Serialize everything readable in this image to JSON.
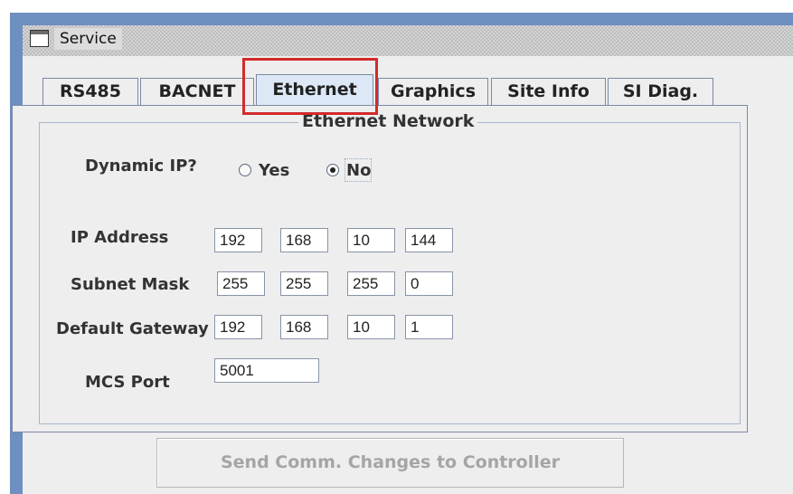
{
  "window": {
    "title": "Service",
    "icon": "window-icon"
  },
  "tabs": [
    {
      "label": "RS485",
      "active": false
    },
    {
      "label": "BACNET",
      "active": false
    },
    {
      "label": "Ethernet",
      "active": true
    },
    {
      "label": "Graphics",
      "active": false
    },
    {
      "label": "Site Info",
      "active": false
    },
    {
      "label": "SI Diag.",
      "active": false
    }
  ],
  "group": {
    "title": "Ethernet Network"
  },
  "dynamic_ip": {
    "label": "Dynamic IP?",
    "options": [
      {
        "label": "Yes",
        "selected": false
      },
      {
        "label": "No",
        "selected": true
      }
    ]
  },
  "ip_address": {
    "label": "IP Address",
    "octets": [
      "192",
      "168",
      "10",
      "144"
    ]
  },
  "subnet_mask": {
    "label": "Subnet Mask",
    "octets": [
      "255",
      "255",
      "255",
      "0"
    ]
  },
  "default_gateway": {
    "label": "Default Gateway",
    "octets": [
      "192",
      "168",
      "10",
      "1"
    ]
  },
  "mcs_port": {
    "label": "MCS Port",
    "value": "5001"
  },
  "send_button": {
    "label": "Send Comm. Changes to Controller",
    "enabled": false
  },
  "colors": {
    "highlight": "#d32a2a",
    "active_tab": "#dce8f5",
    "window_frame": "#6e8fc0"
  }
}
